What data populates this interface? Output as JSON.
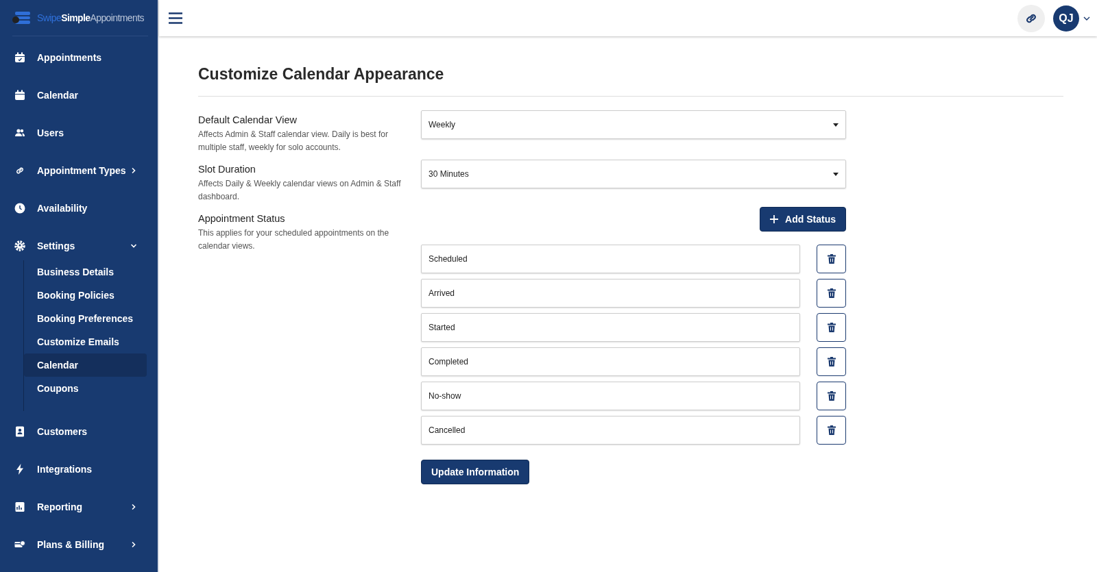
{
  "logo": {
    "parts": [
      "Swipe",
      "Simple",
      "Appointments"
    ]
  },
  "sidebar": {
    "items": [
      {
        "label": "Appointments",
        "selected": false
      },
      {
        "label": "Calendar",
        "selected": false
      },
      {
        "label": "Users",
        "selected": false
      },
      {
        "label": "Appointment Types",
        "selected": false,
        "expanded": false
      },
      {
        "label": "Availability",
        "selected": false
      },
      {
        "label": "Settings",
        "selected": false,
        "expanded": true,
        "children": [
          {
            "label": "Business Details",
            "selected": false
          },
          {
            "label": "Booking Policies",
            "selected": false
          },
          {
            "label": "Booking Preferences",
            "selected": false
          },
          {
            "label": "Customize Emails",
            "selected": false
          },
          {
            "label": "Calendar",
            "selected": true
          },
          {
            "label": "Coupons",
            "selected": false
          }
        ]
      },
      {
        "label": "Customers",
        "selected": false
      },
      {
        "label": "Integrations",
        "selected": false
      },
      {
        "label": "Reporting",
        "selected": false,
        "expanded": false
      },
      {
        "label": "Plans & Billing",
        "selected": false,
        "expanded": false
      }
    ]
  },
  "header": {
    "avatar": "QJ"
  },
  "page": {
    "title": "Customize Calendar Appearance",
    "settings": [
      {
        "kind": "select",
        "label": "Default Calendar View",
        "description": "Affects Admin & Staff calendar view. Daily is best for multiple staff, weekly for solo accounts.",
        "value": "Weekly"
      },
      {
        "kind": "select",
        "label": "Slot Duration",
        "description": "Affects Daily & Weekly calendar views on Admin & Staff dashboard.",
        "value": "30 Minutes"
      },
      {
        "kind": "statuses",
        "label": "Appointment Status",
        "description": "This applies for your scheduled appointments on the calendar views.",
        "button": "Add Status",
        "statuses": [
          "Scheduled",
          "Arrived",
          "Started",
          "Completed",
          "No-show",
          "Cancelled"
        ]
      }
    ],
    "submit": "Update Information"
  }
}
